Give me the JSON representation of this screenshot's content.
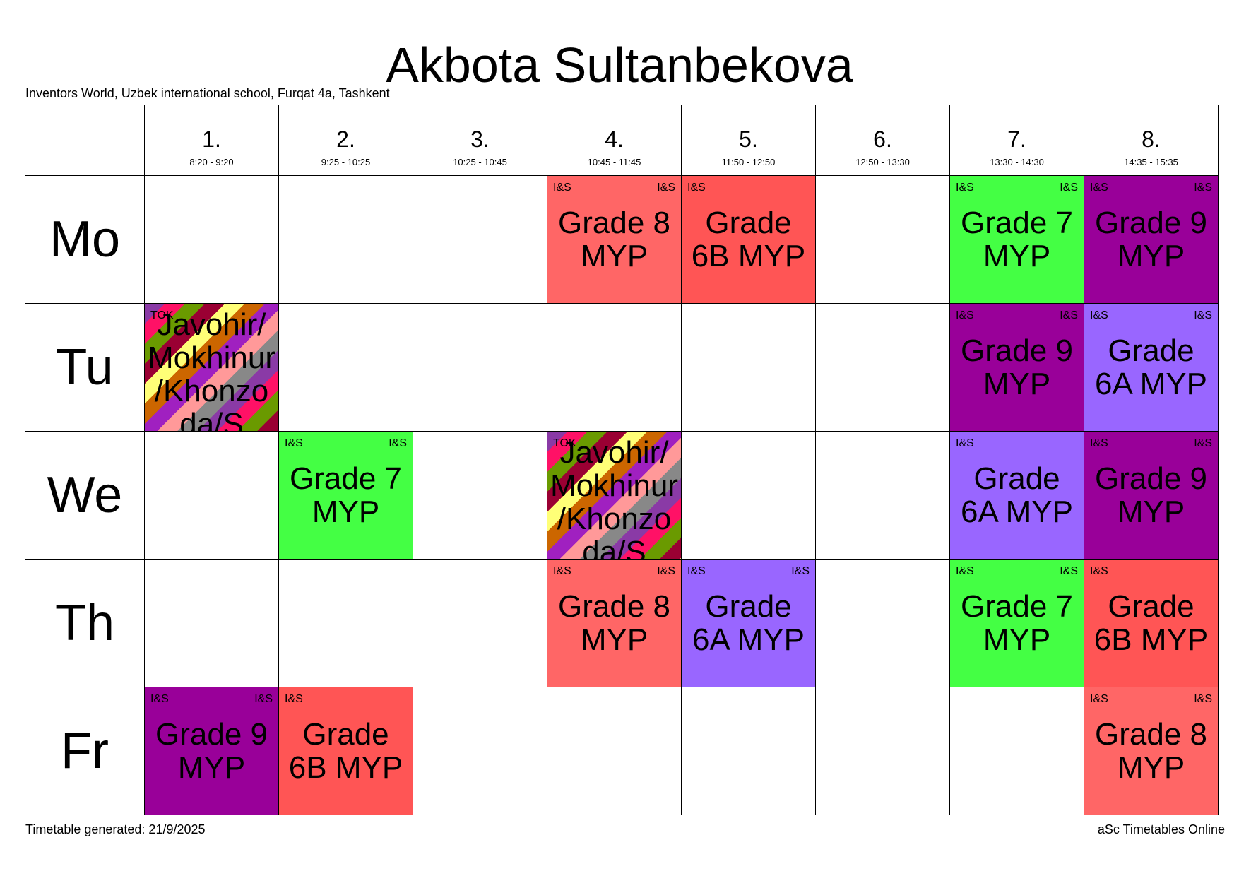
{
  "header": {
    "title": "Akbota Sultanbekova",
    "school": "Inventors World, Uzbek international school, Furqat 4a, Tashkent"
  },
  "footer": {
    "generated": "Timetable generated: 21/9/2025",
    "brand": "aSc Timetables Online"
  },
  "periods": [
    {
      "num": "1.",
      "time": "8:20 - 9:20"
    },
    {
      "num": "2.",
      "time": "9:25 - 10:25"
    },
    {
      "num": "3.",
      "time": "10:25 - 10:45"
    },
    {
      "num": "4.",
      "time": "10:45 - 11:45"
    },
    {
      "num": "5.",
      "time": "11:50 - 12:50"
    },
    {
      "num": "6.",
      "time": "12:50 - 13:30"
    },
    {
      "num": "7.",
      "time": "13:30 - 14:30"
    },
    {
      "num": "8.",
      "time": "14:35 - 15:35"
    }
  ],
  "colors": {
    "grade8": "#ff6666",
    "grade6b": "#ff5555",
    "grade7": "#44ff44",
    "grade9": "#990099",
    "grade6a": "#9966ff"
  },
  "days": [
    {
      "name": "Mo",
      "cells": [
        null,
        null,
        null,
        {
          "tl": "I&S",
          "tr": "I&S",
          "name": "Grade 8 MYP",
          "color": "#ff6666"
        },
        {
          "tl": "I&S",
          "tr": "",
          "name": "Grade 6B MYP",
          "color": "#ff5555"
        },
        null,
        {
          "tl": "I&S",
          "tr": "I&S",
          "name": "Grade 7 MYP",
          "color": "#44ff44"
        },
        {
          "tl": "I&S",
          "tr": "I&S",
          "name": "Grade 9 MYP",
          "color": "#990099"
        }
      ]
    },
    {
      "name": "Tu",
      "cells": [
        {
          "tl": "TOK",
          "tr": "",
          "name": "Javohir/Mokhinur/Khonzoda/S",
          "striped": true
        },
        null,
        null,
        null,
        null,
        null,
        {
          "tl": "I&S",
          "tr": "I&S",
          "name": "Grade 9 MYP",
          "color": "#990099"
        },
        {
          "tl": "I&S",
          "tr": "I&S",
          "name": "Grade 6A MYP",
          "color": "#9966ff"
        }
      ]
    },
    {
      "name": "We",
      "cells": [
        null,
        {
          "tl": "I&S",
          "tr": "I&S",
          "name": "Grade 7 MYP",
          "color": "#44ff44"
        },
        null,
        {
          "tl": "TOK",
          "tr": "",
          "name": "Javohir/Mokhinur/Khonzoda/S",
          "striped": true
        },
        null,
        null,
        {
          "tl": "I&S",
          "tr": "",
          "name": "Grade 6A MYP",
          "color": "#9966ff"
        },
        {
          "tl": "I&S",
          "tr": "I&S",
          "name": "Grade 9 MYP",
          "color": "#990099"
        }
      ]
    },
    {
      "name": "Th",
      "cells": [
        null,
        null,
        null,
        {
          "tl": "I&S",
          "tr": "I&S",
          "name": "Grade 8 MYP",
          "color": "#ff6666"
        },
        {
          "tl": "I&S",
          "tr": "I&S",
          "name": "Grade 6A MYP",
          "color": "#9966ff"
        },
        null,
        {
          "tl": "I&S",
          "tr": "I&S",
          "name": "Grade 7 MYP",
          "color": "#44ff44"
        },
        {
          "tl": "I&S",
          "tr": "",
          "name": "Grade 6B MYP",
          "color": "#ff5555"
        }
      ]
    },
    {
      "name": "Fr",
      "cells": [
        {
          "tl": "I&S",
          "tr": "I&S",
          "name": "Grade 9 MYP",
          "color": "#990099"
        },
        {
          "tl": "I&S",
          "tr": "",
          "name": "Grade 6B MYP",
          "color": "#ff5555"
        },
        null,
        null,
        null,
        null,
        null,
        {
          "tl": "I&S",
          "tr": "I&S",
          "name": "Grade 8 MYP",
          "color": "#ff6666"
        }
      ]
    }
  ]
}
